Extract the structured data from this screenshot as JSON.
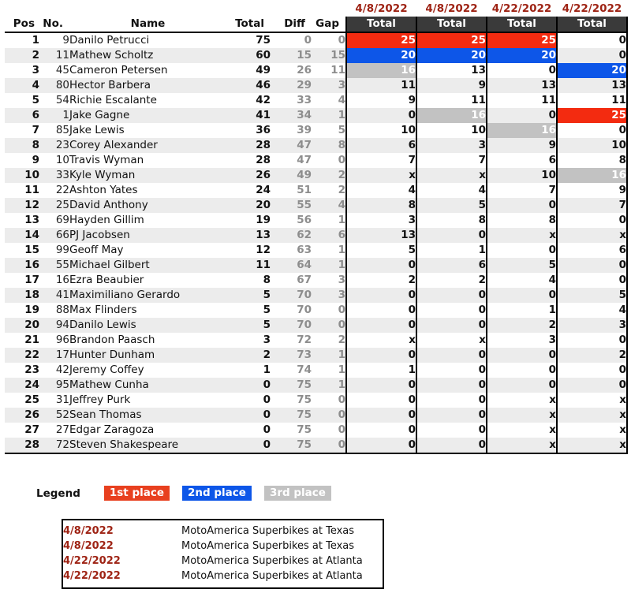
{
  "table": {
    "dates": [
      "4/8/2022",
      "4/8/2022",
      "4/22/2022",
      "4/22/2022"
    ],
    "headers": {
      "pos": "Pos",
      "no": "No.",
      "name": "Name",
      "total": "Total",
      "diff": "Diff",
      "gap": "Gap",
      "race_total": "Total"
    },
    "rows": [
      {
        "pos": "1",
        "no": "9",
        "name": "Danilo Petrucci",
        "total": "75",
        "diff": "0",
        "gap": "0",
        "races": [
          {
            "v": "25",
            "hl": "p1"
          },
          {
            "v": "25",
            "hl": "p1"
          },
          {
            "v": "25",
            "hl": "p1"
          },
          {
            "v": "0",
            "hl": ""
          }
        ]
      },
      {
        "pos": "2",
        "no": "11",
        "name": "Mathew Scholtz",
        "total": "60",
        "diff": "15",
        "gap": "15",
        "races": [
          {
            "v": "20",
            "hl": "p2"
          },
          {
            "v": "20",
            "hl": "p2"
          },
          {
            "v": "20",
            "hl": "p2"
          },
          {
            "v": "0",
            "hl": ""
          }
        ]
      },
      {
        "pos": "3",
        "no": "45",
        "name": "Cameron Petersen",
        "total": "49",
        "diff": "26",
        "gap": "11",
        "races": [
          {
            "v": "16",
            "hl": "p3"
          },
          {
            "v": "13",
            "hl": ""
          },
          {
            "v": "0",
            "hl": ""
          },
          {
            "v": "20",
            "hl": "p2"
          }
        ]
      },
      {
        "pos": "4",
        "no": "80",
        "name": "Hector Barbera",
        "total": "46",
        "diff": "29",
        "gap": "3",
        "races": [
          {
            "v": "11",
            "hl": ""
          },
          {
            "v": "9",
            "hl": ""
          },
          {
            "v": "13",
            "hl": ""
          },
          {
            "v": "13",
            "hl": ""
          }
        ]
      },
      {
        "pos": "5",
        "no": "54",
        "name": "Richie Escalante",
        "total": "42",
        "diff": "33",
        "gap": "4",
        "races": [
          {
            "v": "9",
            "hl": ""
          },
          {
            "v": "11",
            "hl": ""
          },
          {
            "v": "11",
            "hl": ""
          },
          {
            "v": "11",
            "hl": ""
          }
        ]
      },
      {
        "pos": "6",
        "no": "1",
        "name": "Jake Gagne",
        "total": "41",
        "diff": "34",
        "gap": "1",
        "races": [
          {
            "v": "0",
            "hl": ""
          },
          {
            "v": "16",
            "hl": "p3"
          },
          {
            "v": "0",
            "hl": ""
          },
          {
            "v": "25",
            "hl": "p1"
          }
        ]
      },
      {
        "pos": "7",
        "no": "85",
        "name": "Jake Lewis",
        "total": "36",
        "diff": "39",
        "gap": "5",
        "races": [
          {
            "v": "10",
            "hl": ""
          },
          {
            "v": "10",
            "hl": ""
          },
          {
            "v": "16",
            "hl": "p3"
          },
          {
            "v": "0",
            "hl": ""
          }
        ]
      },
      {
        "pos": "8",
        "no": "23",
        "name": "Corey Alexander",
        "total": "28",
        "diff": "47",
        "gap": "8",
        "races": [
          {
            "v": "6",
            "hl": ""
          },
          {
            "v": "3",
            "hl": ""
          },
          {
            "v": "9",
            "hl": ""
          },
          {
            "v": "10",
            "hl": ""
          }
        ]
      },
      {
        "pos": "9",
        "no": "10",
        "name": "Travis Wyman",
        "total": "28",
        "diff": "47",
        "gap": "0",
        "races": [
          {
            "v": "7",
            "hl": ""
          },
          {
            "v": "7",
            "hl": ""
          },
          {
            "v": "6",
            "hl": ""
          },
          {
            "v": "8",
            "hl": ""
          }
        ]
      },
      {
        "pos": "10",
        "no": "33",
        "name": "Kyle Wyman",
        "total": "26",
        "diff": "49",
        "gap": "2",
        "races": [
          {
            "v": "x",
            "hl": ""
          },
          {
            "v": "x",
            "hl": ""
          },
          {
            "v": "10",
            "hl": ""
          },
          {
            "v": "16",
            "hl": "p3"
          }
        ]
      },
      {
        "pos": "11",
        "no": "22",
        "name": "Ashton Yates",
        "total": "24",
        "diff": "51",
        "gap": "2",
        "races": [
          {
            "v": "4",
            "hl": ""
          },
          {
            "v": "4",
            "hl": ""
          },
          {
            "v": "7",
            "hl": ""
          },
          {
            "v": "9",
            "hl": ""
          }
        ]
      },
      {
        "pos": "12",
        "no": "25",
        "name": "David Anthony",
        "total": "20",
        "diff": "55",
        "gap": "4",
        "races": [
          {
            "v": "8",
            "hl": ""
          },
          {
            "v": "5",
            "hl": ""
          },
          {
            "v": "0",
            "hl": ""
          },
          {
            "v": "7",
            "hl": ""
          }
        ]
      },
      {
        "pos": "13",
        "no": "69",
        "name": "Hayden Gillim",
        "total": "19",
        "diff": "56",
        "gap": "1",
        "races": [
          {
            "v": "3",
            "hl": ""
          },
          {
            "v": "8",
            "hl": ""
          },
          {
            "v": "8",
            "hl": ""
          },
          {
            "v": "0",
            "hl": ""
          }
        ]
      },
      {
        "pos": "14",
        "no": "66",
        "name": "PJ Jacobsen",
        "total": "13",
        "diff": "62",
        "gap": "6",
        "races": [
          {
            "v": "13",
            "hl": ""
          },
          {
            "v": "0",
            "hl": ""
          },
          {
            "v": "x",
            "hl": ""
          },
          {
            "v": "x",
            "hl": ""
          }
        ]
      },
      {
        "pos": "15",
        "no": "99",
        "name": "Geoff May",
        "total": "12",
        "diff": "63",
        "gap": "1",
        "races": [
          {
            "v": "5",
            "hl": ""
          },
          {
            "v": "1",
            "hl": ""
          },
          {
            "v": "0",
            "hl": ""
          },
          {
            "v": "6",
            "hl": ""
          }
        ]
      },
      {
        "pos": "16",
        "no": "55",
        "name": "Michael Gilbert",
        "total": "11",
        "diff": "64",
        "gap": "1",
        "races": [
          {
            "v": "0",
            "hl": ""
          },
          {
            "v": "6",
            "hl": ""
          },
          {
            "v": "5",
            "hl": ""
          },
          {
            "v": "0",
            "hl": ""
          }
        ]
      },
      {
        "pos": "17",
        "no": "16",
        "name": "Ezra Beaubier",
        "total": "8",
        "diff": "67",
        "gap": "3",
        "races": [
          {
            "v": "2",
            "hl": ""
          },
          {
            "v": "2",
            "hl": ""
          },
          {
            "v": "4",
            "hl": ""
          },
          {
            "v": "0",
            "hl": ""
          }
        ]
      },
      {
        "pos": "18",
        "no": "41",
        "name": "Maximiliano Gerardo",
        "total": "5",
        "diff": "70",
        "gap": "3",
        "races": [
          {
            "v": "0",
            "hl": ""
          },
          {
            "v": "0",
            "hl": ""
          },
          {
            "v": "0",
            "hl": ""
          },
          {
            "v": "5",
            "hl": ""
          }
        ]
      },
      {
        "pos": "19",
        "no": "88",
        "name": "Max Flinders",
        "total": "5",
        "diff": "70",
        "gap": "0",
        "races": [
          {
            "v": "0",
            "hl": ""
          },
          {
            "v": "0",
            "hl": ""
          },
          {
            "v": "1",
            "hl": ""
          },
          {
            "v": "4",
            "hl": ""
          }
        ]
      },
      {
        "pos": "20",
        "no": "94",
        "name": "Danilo Lewis",
        "total": "5",
        "diff": "70",
        "gap": "0",
        "races": [
          {
            "v": "0",
            "hl": ""
          },
          {
            "v": "0",
            "hl": ""
          },
          {
            "v": "2",
            "hl": ""
          },
          {
            "v": "3",
            "hl": ""
          }
        ]
      },
      {
        "pos": "21",
        "no": "96",
        "name": "Brandon Paasch",
        "total": "3",
        "diff": "72",
        "gap": "2",
        "races": [
          {
            "v": "x",
            "hl": ""
          },
          {
            "v": "x",
            "hl": ""
          },
          {
            "v": "3",
            "hl": ""
          },
          {
            "v": "0",
            "hl": ""
          }
        ]
      },
      {
        "pos": "22",
        "no": "17",
        "name": "Hunter Dunham",
        "total": "2",
        "diff": "73",
        "gap": "1",
        "races": [
          {
            "v": "0",
            "hl": ""
          },
          {
            "v": "0",
            "hl": ""
          },
          {
            "v": "0",
            "hl": ""
          },
          {
            "v": "2",
            "hl": ""
          }
        ]
      },
      {
        "pos": "23",
        "no": "42",
        "name": "Jeremy Coffey",
        "total": "1",
        "diff": "74",
        "gap": "1",
        "races": [
          {
            "v": "1",
            "hl": ""
          },
          {
            "v": "0",
            "hl": ""
          },
          {
            "v": "0",
            "hl": ""
          },
          {
            "v": "0",
            "hl": ""
          }
        ]
      },
      {
        "pos": "24",
        "no": "95",
        "name": "Mathew Cunha",
        "total": "0",
        "diff": "75",
        "gap": "1",
        "races": [
          {
            "v": "0",
            "hl": ""
          },
          {
            "v": "0",
            "hl": ""
          },
          {
            "v": "0",
            "hl": ""
          },
          {
            "v": "0",
            "hl": ""
          }
        ]
      },
      {
        "pos": "25",
        "no": "31",
        "name": "Jeffrey Purk",
        "total": "0",
        "diff": "75",
        "gap": "0",
        "races": [
          {
            "v": "0",
            "hl": ""
          },
          {
            "v": "0",
            "hl": ""
          },
          {
            "v": "x",
            "hl": ""
          },
          {
            "v": "x",
            "hl": ""
          }
        ]
      },
      {
        "pos": "26",
        "no": "52",
        "name": "Sean Thomas",
        "total": "0",
        "diff": "75",
        "gap": "0",
        "races": [
          {
            "v": "0",
            "hl": ""
          },
          {
            "v": "0",
            "hl": ""
          },
          {
            "v": "x",
            "hl": ""
          },
          {
            "v": "x",
            "hl": ""
          }
        ]
      },
      {
        "pos": "27",
        "no": "27",
        "name": "Edgar Zaragoza",
        "total": "0",
        "diff": "75",
        "gap": "0",
        "races": [
          {
            "v": "0",
            "hl": ""
          },
          {
            "v": "0",
            "hl": ""
          },
          {
            "v": "x",
            "hl": ""
          },
          {
            "v": "x",
            "hl": ""
          }
        ]
      },
      {
        "pos": "28",
        "no": "72",
        "name": "Steven Shakespeare",
        "total": "0",
        "diff": "75",
        "gap": "0",
        "races": [
          {
            "v": "0",
            "hl": ""
          },
          {
            "v": "0",
            "hl": ""
          },
          {
            "v": "x",
            "hl": ""
          },
          {
            "v": "x",
            "hl": ""
          }
        ]
      }
    ]
  },
  "legend": {
    "label": "Legend",
    "items": [
      {
        "text": "1st place",
        "color": "#e8401f"
      },
      {
        "text": "2nd place",
        "color": "#0d56e8"
      },
      {
        "text": "3rd place",
        "color": "#c2c2c2"
      }
    ]
  },
  "events": [
    {
      "date": "4/8/2022",
      "name": "MotoAmerica Superbikes at Texas"
    },
    {
      "date": "4/8/2022",
      "name": "MotoAmerica Superbikes at Texas"
    },
    {
      "date": "4/22/2022",
      "name": "MotoAmerica Superbikes at Atlanta"
    },
    {
      "date": "4/22/2022",
      "name": "MotoAmerica Superbikes at Atlanta"
    }
  ],
  "chart_data": {
    "type": "table",
    "title": "MotoAmerica Superbike Championship Standings",
    "columns": [
      "Pos",
      "No.",
      "Name",
      "Total",
      "Diff",
      "Gap",
      "4/8/2022 Total",
      "4/8/2022 Total",
      "4/22/2022 Total",
      "4/22/2022 Total"
    ],
    "rows": [
      [
        "1",
        "9",
        "Danilo Petrucci",
        "75",
        "0",
        "0",
        "25",
        "25",
        "25",
        "0"
      ],
      [
        "2",
        "11",
        "Mathew Scholtz",
        "60",
        "15",
        "15",
        "20",
        "20",
        "20",
        "0"
      ],
      [
        "3",
        "45",
        "Cameron Petersen",
        "49",
        "26",
        "11",
        "16",
        "13",
        "0",
        "20"
      ],
      [
        "4",
        "80",
        "Hector Barbera",
        "46",
        "29",
        "3",
        "11",
        "9",
        "13",
        "13"
      ],
      [
        "5",
        "54",
        "Richie Escalante",
        "42",
        "33",
        "4",
        "9",
        "11",
        "11",
        "11"
      ],
      [
        "6",
        "1",
        "Jake Gagne",
        "41",
        "34",
        "1",
        "0",
        "16",
        "0",
        "25"
      ],
      [
        "7",
        "85",
        "Jake Lewis",
        "36",
        "39",
        "5",
        "10",
        "10",
        "16",
        "0"
      ],
      [
        "8",
        "23",
        "Corey Alexander",
        "28",
        "47",
        "8",
        "6",
        "3",
        "9",
        "10"
      ],
      [
        "9",
        "10",
        "Travis Wyman",
        "28",
        "47",
        "0",
        "7",
        "7",
        "6",
        "8"
      ],
      [
        "10",
        "33",
        "Kyle Wyman",
        "26",
        "49",
        "2",
        "x",
        "x",
        "10",
        "16"
      ],
      [
        "11",
        "22",
        "Ashton Yates",
        "24",
        "51",
        "2",
        "4",
        "4",
        "7",
        "9"
      ],
      [
        "12",
        "25",
        "David Anthony",
        "20",
        "55",
        "4",
        "8",
        "5",
        "0",
        "7"
      ],
      [
        "13",
        "69",
        "Hayden Gillim",
        "19",
        "56",
        "1",
        "3",
        "8",
        "8",
        "0"
      ],
      [
        "14",
        "66",
        "PJ Jacobsen",
        "13",
        "62",
        "6",
        "13",
        "0",
        "x",
        "x"
      ],
      [
        "15",
        "99",
        "Geoff May",
        "12",
        "63",
        "1",
        "5",
        "1",
        "0",
        "6"
      ],
      [
        "16",
        "55",
        "Michael Gilbert",
        "11",
        "64",
        "1",
        "0",
        "6",
        "5",
        "0"
      ],
      [
        "17",
        "16",
        "Ezra Beaubier",
        "8",
        "67",
        "3",
        "2",
        "2",
        "4",
        "0"
      ],
      [
        "18",
        "41",
        "Maximiliano Gerardo",
        "5",
        "70",
        "3",
        "0",
        "0",
        "0",
        "5"
      ],
      [
        "19",
        "88",
        "Max Flinders",
        "5",
        "70",
        "0",
        "0",
        "0",
        "1",
        "4"
      ],
      [
        "20",
        "94",
        "Danilo Lewis",
        "5",
        "70",
        "0",
        "0",
        "0",
        "2",
        "3"
      ],
      [
        "21",
        "96",
        "Brandon Paasch",
        "3",
        "72",
        "2",
        "x",
        "x",
        "3",
        "0"
      ],
      [
        "22",
        "17",
        "Hunter Dunham",
        "2",
        "73",
        "1",
        "0",
        "0",
        "0",
        "2"
      ],
      [
        "23",
        "42",
        "Jeremy Coffey",
        "1",
        "74",
        "1",
        "1",
        "0",
        "0",
        "0"
      ],
      [
        "24",
        "95",
        "Mathew Cunha",
        "0",
        "75",
        "1",
        "0",
        "0",
        "0",
        "0"
      ],
      [
        "25",
        "31",
        "Jeffrey Purk",
        "0",
        "75",
        "0",
        "0",
        "0",
        "x",
        "x"
      ],
      [
        "26",
        "52",
        "Sean Thomas",
        "0",
        "75",
        "0",
        "0",
        "0",
        "x",
        "x"
      ],
      [
        "27",
        "27",
        "Edgar Zaragoza",
        "0",
        "75",
        "0",
        "0",
        "0",
        "x",
        "x"
      ],
      [
        "28",
        "72",
        "Steven Shakespeare",
        "0",
        "75",
        "0",
        "0",
        "0",
        "x",
        "x"
      ]
    ]
  }
}
